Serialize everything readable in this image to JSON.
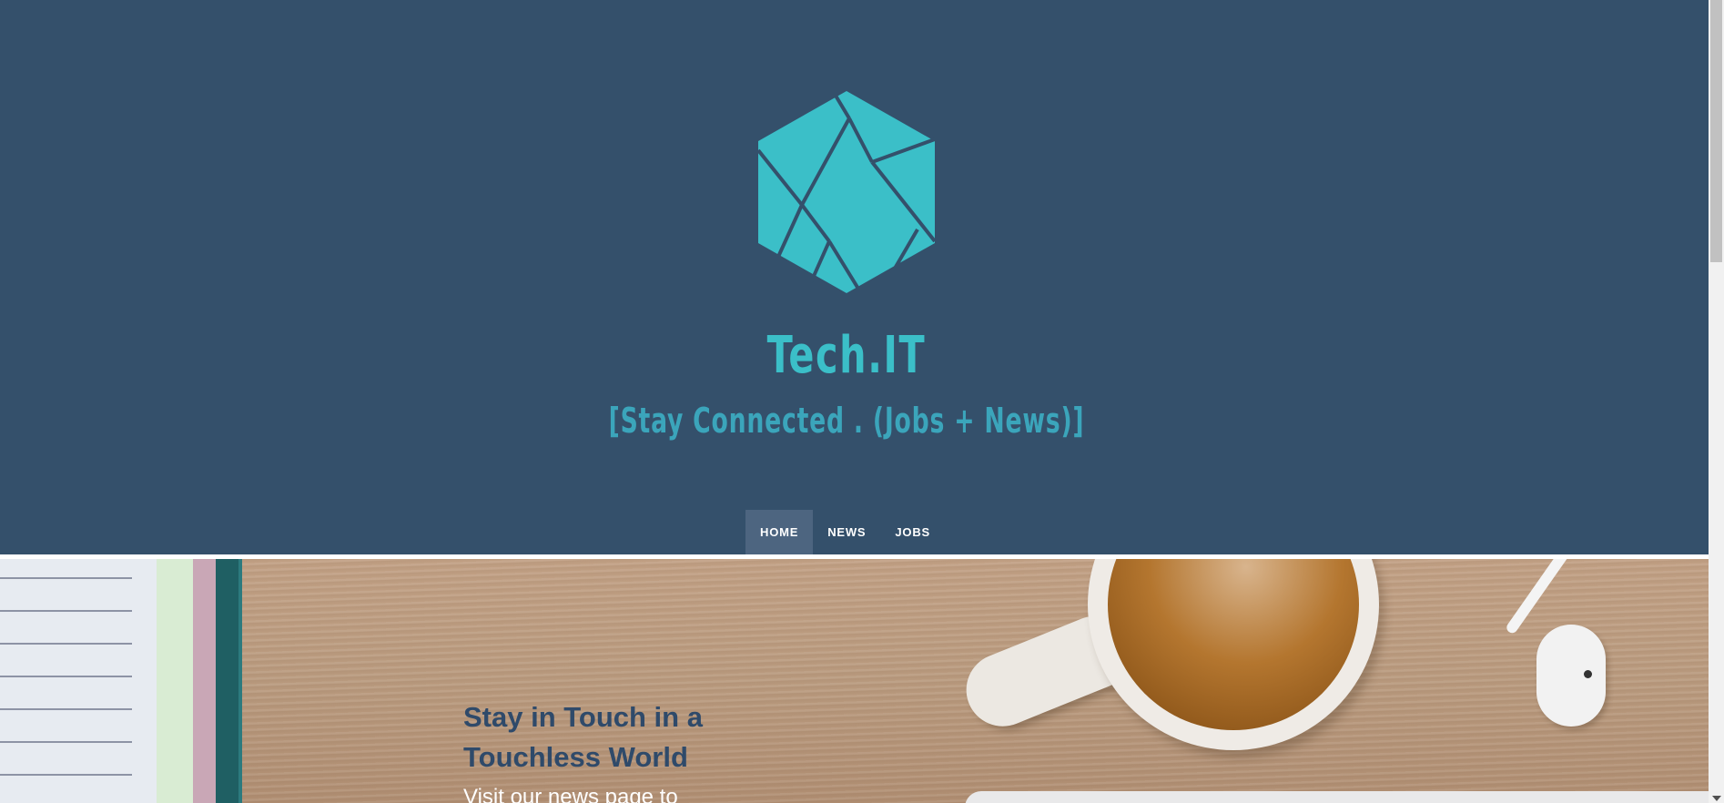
{
  "site": {
    "title": "Tech.IT",
    "tagline": "[Stay Connected . (Jobs + News)]",
    "logo_icon": "hexagon-logo-icon"
  },
  "nav": {
    "items": [
      {
        "label": "HOME",
        "active": true
      },
      {
        "label": "NEWS",
        "active": false
      },
      {
        "label": "JOBS",
        "active": false
      }
    ]
  },
  "hero": {
    "title": "Stay in Touch in a Touchless World",
    "subtitle": "Visit our news page to"
  },
  "colors": {
    "header_bg": "#34506b",
    "accent": "#3bbfc8",
    "nav_active_bg": "#4d6580",
    "hero_title": "#2f4a6a"
  }
}
